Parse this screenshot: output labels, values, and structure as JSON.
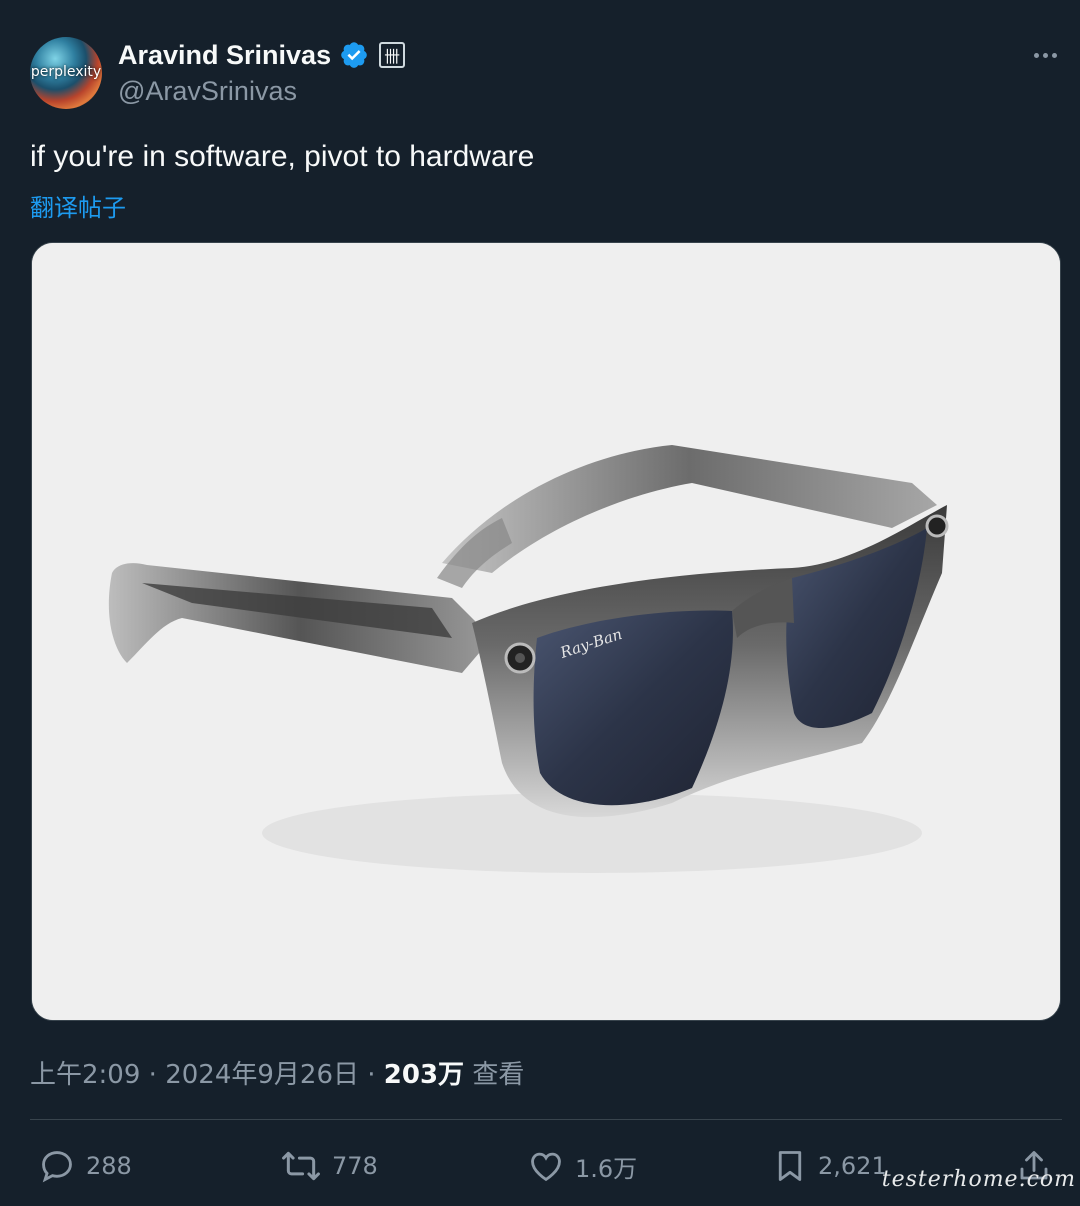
{
  "author": {
    "avatar_text": "perplexity",
    "display_name": "Aravind Srinivas",
    "handle": "@AravSrinivas",
    "affiliation_badge": "卌"
  },
  "tweet": {
    "text": "if you're in software, pivot to hardware",
    "translate_label": "翻译帖子"
  },
  "media": {
    "brand_text": "Ray-Ban"
  },
  "meta": {
    "time": "上午2:09",
    "separator": " · ",
    "date": "2024年9月26日",
    "views_count": "203万",
    "views_label": " 查看"
  },
  "actions": {
    "replies": "288",
    "reposts": "778",
    "likes": "1.6万",
    "bookmarks": "2,621"
  },
  "watermark": "testerhome.com",
  "colors": {
    "background": "#15202b",
    "link": "#1d9bf0",
    "secondary_text": "#8b98a5",
    "verified": "#1d9bf0"
  }
}
